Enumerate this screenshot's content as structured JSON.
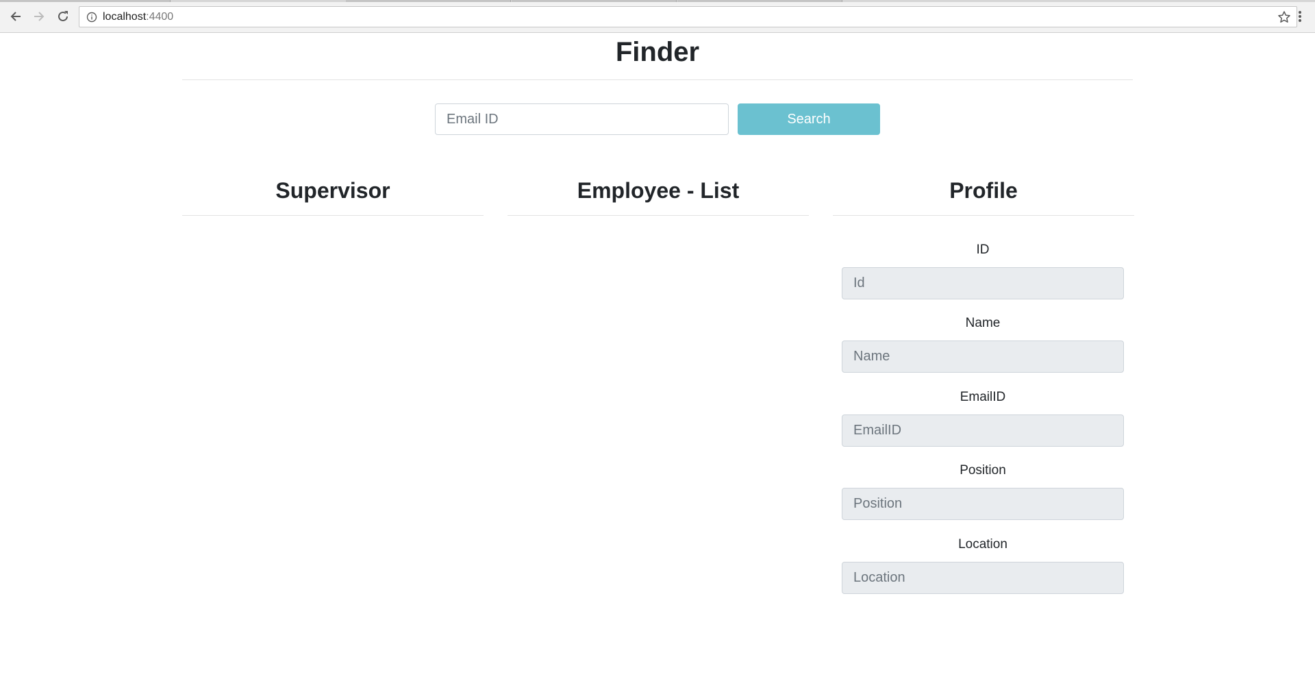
{
  "browser": {
    "url_host": "localhost",
    "url_port": ":4400",
    "icons": [
      "back-arrow-icon",
      "forward-arrow-icon",
      "reload-icon",
      "info-icon",
      "star-icon",
      "kebab-menu-icon"
    ]
  },
  "page": {
    "title": "Finder",
    "search": {
      "placeholder": "Email ID",
      "button_label": "Search"
    },
    "columns": {
      "supervisor": "Supervisor",
      "employee_list": "Employee - List",
      "profile": "Profile"
    },
    "profile_fields": [
      {
        "label": "ID",
        "placeholder": "Id"
      },
      {
        "label": "Name",
        "placeholder": "Name"
      },
      {
        "label": "EmailID",
        "placeholder": "EmailID"
      },
      {
        "label": "Position",
        "placeholder": "Position"
      },
      {
        "label": "Location",
        "placeholder": "Location"
      }
    ]
  },
  "colors": {
    "search_button": "#6bc1d0",
    "readonly_input_bg": "#e9ecef",
    "text": "#212529"
  }
}
